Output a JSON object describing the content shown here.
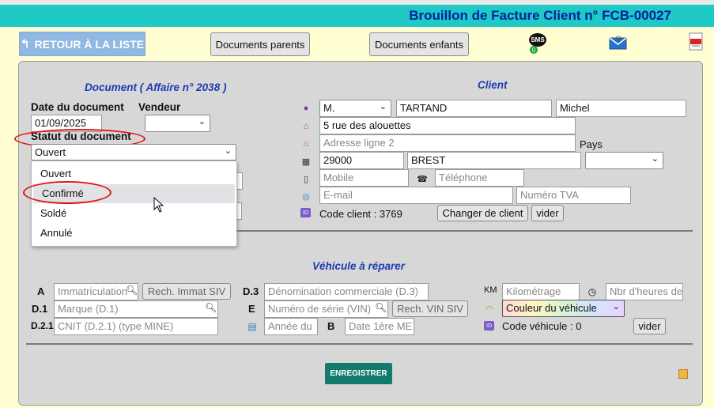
{
  "header": {
    "title": "Brouillon de Facture Client n° FCB-00027"
  },
  "toolbar": {
    "back_label": "RETOUR À LA LISTE",
    "parents_label": "Documents parents",
    "children_label": "Documents enfants",
    "sms_label": "SMS",
    "sms_count": "0"
  },
  "document": {
    "title": "Document ( Affaire n° 2038 )",
    "date_label": "Date du document",
    "date_value": "01/09/2025",
    "vendeur_label": "Vendeur",
    "status_label": "Statut du document",
    "status_value": "Ouvert",
    "status_options": [
      "Ouvert",
      "Confirmé",
      "Soldé",
      "Annulé"
    ]
  },
  "client": {
    "title": "Client",
    "civility": "M.",
    "lastname": "TARTAND",
    "firstname": "Michel",
    "address1": "5 rue des alouettes",
    "address2_placeholder": "Adresse ligne 2",
    "pays_label": "Pays",
    "zip": "29000",
    "city": "BREST",
    "mobile_placeholder": "Mobile",
    "phone_placeholder": "Téléphone",
    "email_placeholder": "E-mail",
    "tva_placeholder": "Numéro TVA",
    "code_label": "Code client : ",
    "code_value": "3769",
    "change_label": "Changer de client",
    "clear_label": "vider"
  },
  "vehicle": {
    "title": "Véhicule à réparer",
    "a_label": "A",
    "d1_label": "D.1",
    "d21_label": "D.2.1",
    "d3_label": "D.3",
    "e_label": "E",
    "b_label": "B",
    "km_label": "KM",
    "immat_placeholder": "Immatriculation",
    "rech_immat_label": "Rech. Immat SIV",
    "marque_placeholder": "Marque (D.1)",
    "cnit_placeholder": "CNIT (D.2.1) (type MINE)",
    "denom_placeholder": "Dénomination commerciale (D.3)",
    "serie_placeholder": "Numéro de série (VIN)",
    "rech_vin_label": "Rech. VIN SIV",
    "annee_placeholder": "Année du",
    "date1_placeholder": "Date 1ère ME",
    "km_placeholder": "Kilométrage",
    "hours_placeholder": "Nbr d'heures de",
    "color_value": "Couleur du véhicule",
    "code_label": "Code véhicule : ",
    "code_value": "0",
    "clear_label": "vider"
  },
  "footer": {
    "save_label": "ENREGISTRER"
  },
  "colors": {
    "accent": "#1fc9c6",
    "title": "#00239c",
    "section_title": "#1d3bb5",
    "save": "#137b6c",
    "highlight_circle": "#e01414",
    "page_bg": "#ffffd2"
  }
}
